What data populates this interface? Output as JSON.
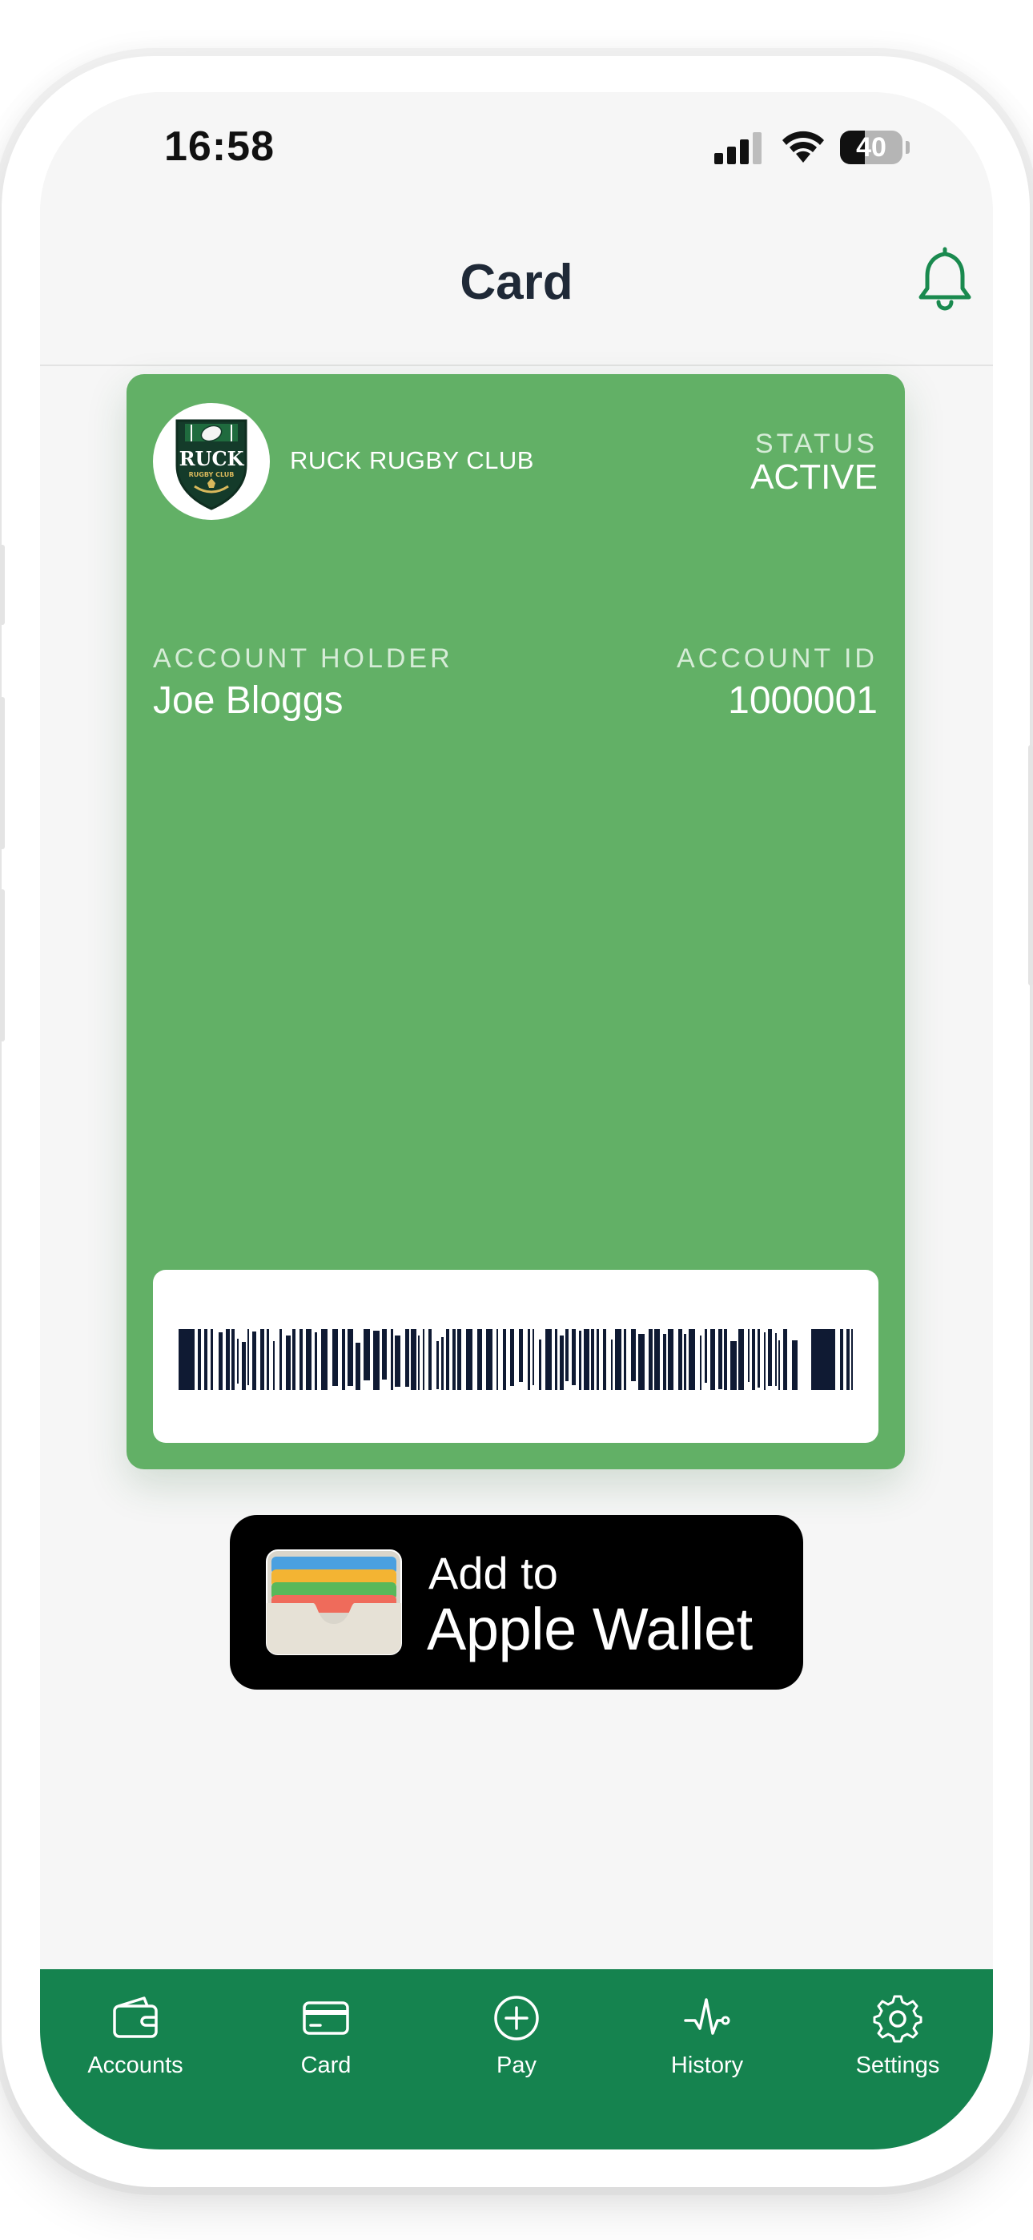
{
  "status_bar": {
    "time": "16:58",
    "battery": "40",
    "battery_level": 0.4
  },
  "header": {
    "title": "Card"
  },
  "card": {
    "club_name": "RUCK RUGBY CLUB",
    "logo_text": "RUCK",
    "logo_subtext": "RUGBY CLUB",
    "status_label": "STATUS",
    "status_value": "ACTIVE",
    "holder_label": "ACCOUNT HOLDER",
    "holder_value": "Joe Bloggs",
    "id_label": "ACCOUNT ID",
    "id_value": "1000001",
    "background_color": "#62b066"
  },
  "wallet_button": {
    "line1": "Add to",
    "line2": "Apple Wallet"
  },
  "tabs": [
    {
      "label": "Accounts",
      "icon": "wallet-icon"
    },
    {
      "label": "Card",
      "icon": "credit-card-icon"
    },
    {
      "label": "Pay",
      "icon": "plus-circle-icon"
    },
    {
      "label": "History",
      "icon": "activity-icon"
    },
    {
      "label": "Settings",
      "icon": "gear-icon"
    }
  ],
  "colors": {
    "tab_bar": "#15834f",
    "accent": "#1a8a4f",
    "title": "#1f2937"
  }
}
